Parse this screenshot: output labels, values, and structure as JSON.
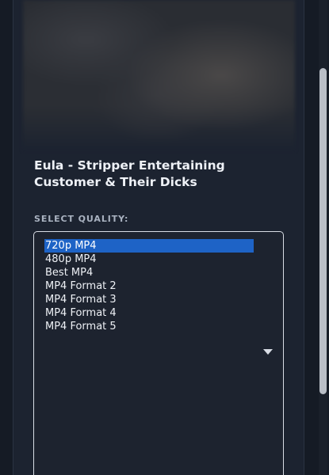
{
  "video": {
    "title": "Eula - Stripper Entertaining Customer & Their Dicks"
  },
  "quality": {
    "label": "SELECT QUALITY:",
    "selected": "720p MP4",
    "options": [
      "720p MP4",
      "480p MP4",
      "Best MP4",
      "MP4 Format 2",
      "MP4 Format 3",
      "MP4 Format 4",
      "MP4 Format 5"
    ]
  },
  "icons": {
    "dropdown": "chevron-down-icon"
  },
  "colors": {
    "background": "#151b25",
    "card": "#1c2330",
    "selected_option": "#1e63c6",
    "text": "#eef1f6"
  }
}
